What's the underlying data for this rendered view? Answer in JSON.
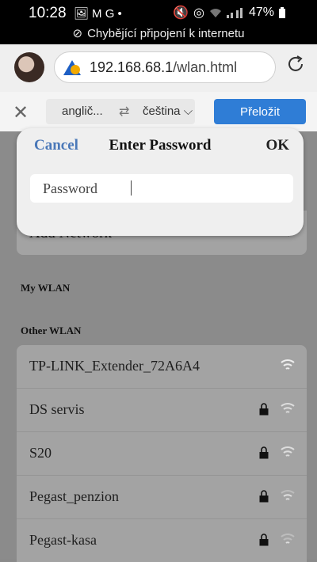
{
  "status_bar": {
    "time": "10:28",
    "left_icons": "🖼 M G •",
    "battery": "47%",
    "offline_notice": "Chybějící připojení k internetu"
  },
  "browser": {
    "url_host": "192.168.68.1",
    "url_path": "/wlan.html"
  },
  "translate_bar": {
    "source_lang": "anglič...",
    "swap_icon": "⇄",
    "target_lang": "čeština ⌵",
    "translate_button": "Přeložit"
  },
  "page": {
    "add_network_label": "Add Network",
    "my_wlan_header": "My WLAN",
    "other_wlan_header": "Other WLAN",
    "networks": [
      {
        "name": "TP-LINK_Extender_72A6A4",
        "locked": false
      },
      {
        "name": "DS servis",
        "locked": true
      },
      {
        "name": "S20",
        "locked": true
      },
      {
        "name": "Pegast_penzion",
        "locked": true
      },
      {
        "name": "Pegast-kasa",
        "locked": true
      }
    ]
  },
  "dialog": {
    "cancel_label": "Cancel",
    "title": "Enter Password",
    "ok_label": "OK",
    "input_placeholder": "Password"
  }
}
